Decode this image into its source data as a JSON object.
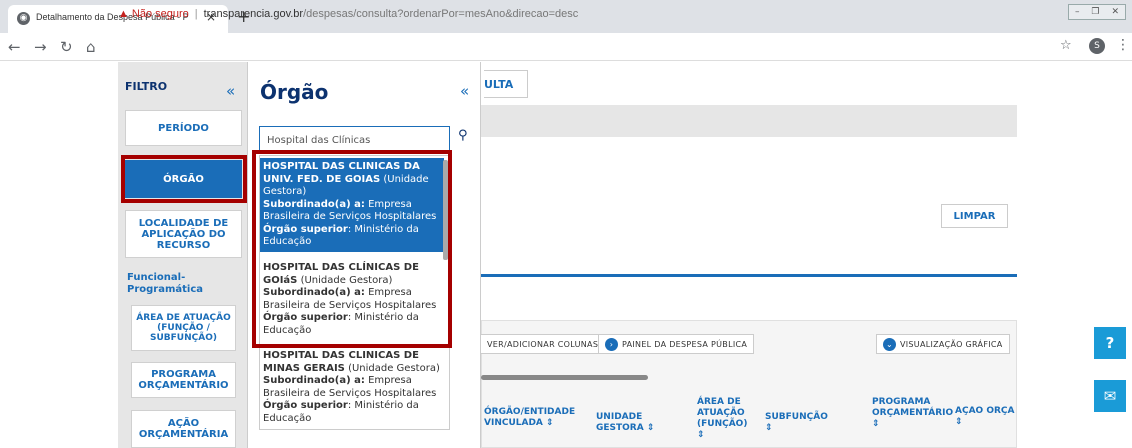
{
  "browser": {
    "tab_title": "Detalhamento da Despesa Pública - P",
    "tab_close": "×",
    "new_tab": "+",
    "url_warning": "Não seguro",
    "url_host": "transparencia.gov.br",
    "url_path": "/despesas/consulta?ordenarPor=mesAno&direcao=desc",
    "profile_initial": "S",
    "window_controls": [
      "–",
      "❐",
      "✕"
    ]
  },
  "filtro": {
    "title": "FILTRO",
    "collapse": "«",
    "periodo": "PERÍODO",
    "orgao": "ÓRGÃO",
    "localidade": "LOCALIDADE DE APLICAÇÃO DO RECURSO",
    "funcional": "Funcional-Programática",
    "area_atuacao": "ÁREA DE ATUAÇÃO (FUNÇÃO / SUBFUNÇÃO)",
    "programa": "PROGRAMA ORÇAMENTÁRIO",
    "acao": "AÇÃO ORÇAMENTÁRIA"
  },
  "orgao_panel": {
    "title": "Órgão",
    "collapse": "«",
    "search_value": "Hospital das Clínicas",
    "items": [
      {
        "name": "HOSPITAL DAS CLINICAS DA UNIV. FED. DE GOIAS",
        "type": "(Unidade Gestora)",
        "sub_label": "Subordinado(a) a:",
        "sub_value": "Empresa Brasileira de Serviços Hospitalares",
        "sup_label": "Órgão superior",
        "sup_value": ": Ministério da Educação"
      },
      {
        "name": "HOSPITAL DAS CLÍNICAS DE GOIáS",
        "type": "(Unidade Gestora)",
        "sub_label": "Subordinado(a) a:",
        "sub_value": "Empresa Brasileira de Serviços Hospitalares",
        "sup_label": "Órgão superior",
        "sup_value": ": Ministério da Educação"
      },
      {
        "name": "HOSPITAL DAS CLINICAS DE MINAS GERAIS",
        "type": "(Unidade Gestora)",
        "sub_label": "Subordinado(a) a:",
        "sub_value": "Empresa Brasileira de Serviços Hospitalares",
        "sup_label": "Órgão superior",
        "sup_value": ": Ministério da Educação"
      }
    ]
  },
  "main": {
    "consulta_btn": "ULTA",
    "limpar": "LIMPAR",
    "btn_colunas": "VER/ADICIONAR COLUNAS",
    "btn_painel": "PAINEL DA DESPESA PÚBLICA",
    "btn_grafica": "VISUALIZAÇÃO GRÁFICA",
    "columns": [
      "ÓRGÃO/ENTIDADE VINCULADA ⇕",
      "UNIDADE GESTORA ⇕",
      "ÁREA DE ATUAÇÃO (FUNÇÃO) ⇕",
      "SUBFUNÇÃO ⇕",
      "PROGRAMA ORÇAMENTÁRIO ⇕",
      "AÇÃO ORÇA ⇕"
    ]
  },
  "colors": {
    "primary": "#1a6db8",
    "dark": "#0c326f",
    "highlight": "#a50000",
    "fab": "#1a9bd7"
  }
}
